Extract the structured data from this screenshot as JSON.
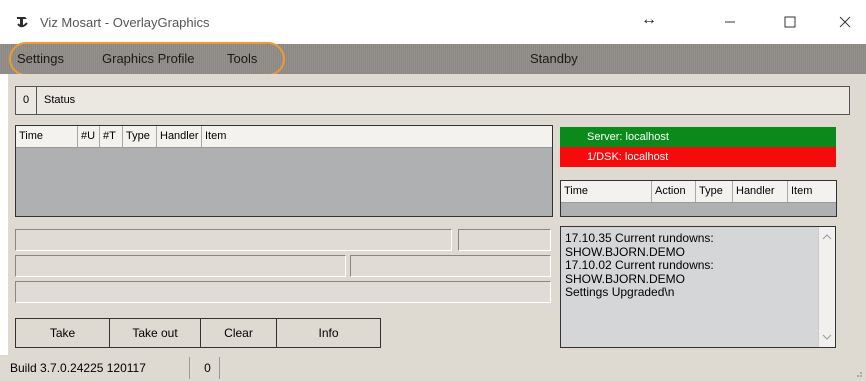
{
  "window": {
    "title": "Viz Mosart - OverlayGraphics",
    "resize_glyph": "↔",
    "controls": {
      "minimize": "—",
      "maximize": "☐",
      "close": "✕"
    }
  },
  "menu": {
    "items": [
      "Settings",
      "Graphics Profile",
      "Tools"
    ],
    "highlight_color": "#f19a35",
    "mode_label": "Standby"
  },
  "status": {
    "count": "0",
    "label": "Status"
  },
  "left_grid": {
    "columns": [
      "Time",
      "#U",
      "#T",
      "Type",
      "Handler",
      "Item"
    ]
  },
  "connections": {
    "server": {
      "label": "Server: localhost",
      "color": "#0b8a1b"
    },
    "dsk": {
      "label": "1/DSK: localhost",
      "color": "#f50b0b"
    }
  },
  "right_grid": {
    "columns": [
      "Time",
      "Action",
      "Type",
      "Handler",
      "Item"
    ]
  },
  "buttons": {
    "take": "Take",
    "take_out": "Take out",
    "clear": "Clear",
    "info": "Info"
  },
  "log": {
    "lines": [
      "17.10.35 Current rundowns:",
      "SHOW.BJORN.DEMO",
      "17.10.02 Current rundowns:",
      "SHOW.BJORN.DEMO",
      "Settings Upgraded\\n"
    ]
  },
  "footer": {
    "build": "Build 3.7.0.24225 120117",
    "count": "0"
  },
  "icons": {
    "app": "app-logo-icon",
    "resize": "resize-arrows-icon",
    "grip": "size-grip-icon"
  }
}
